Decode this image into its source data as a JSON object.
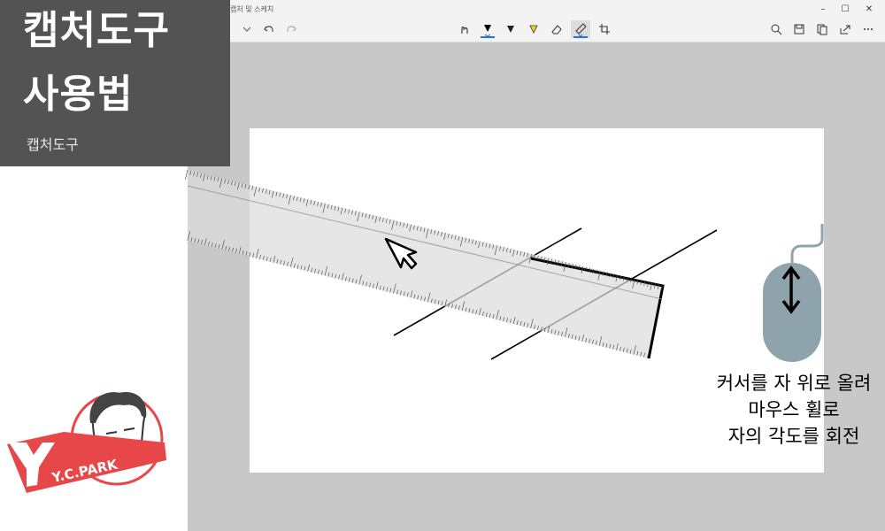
{
  "window": {
    "title": "캡처 및 스케치"
  },
  "window_controls": {
    "minimize": "–",
    "maximize": "☐",
    "close": "✕"
  },
  "toolbar": {
    "tools": [
      "touch-writing-icon",
      "ballpoint-pen-icon",
      "pencil-icon",
      "highlighter-icon",
      "eraser-icon",
      "ruler-icon",
      "crop-icon"
    ],
    "right_tools": [
      "zoom-icon",
      "save-icon",
      "copy-icon",
      "share-icon",
      "more-icon"
    ]
  },
  "banner": {
    "line1": "캡처도구",
    "line2": "사용법",
    "subtitle": "캡처도구"
  },
  "caption": {
    "line1": "커서를 자 위로 올려",
    "line2": "마우스 휠로",
    "line3": "자의 각도를 회전"
  },
  "logo": {
    "text": "Y.C.PARK"
  },
  "colors": {
    "banner_bg": "#535353",
    "mouse_body": "#8fa3ac",
    "logo_red": "#e8474a",
    "accent_blue": "#2c70c9"
  }
}
